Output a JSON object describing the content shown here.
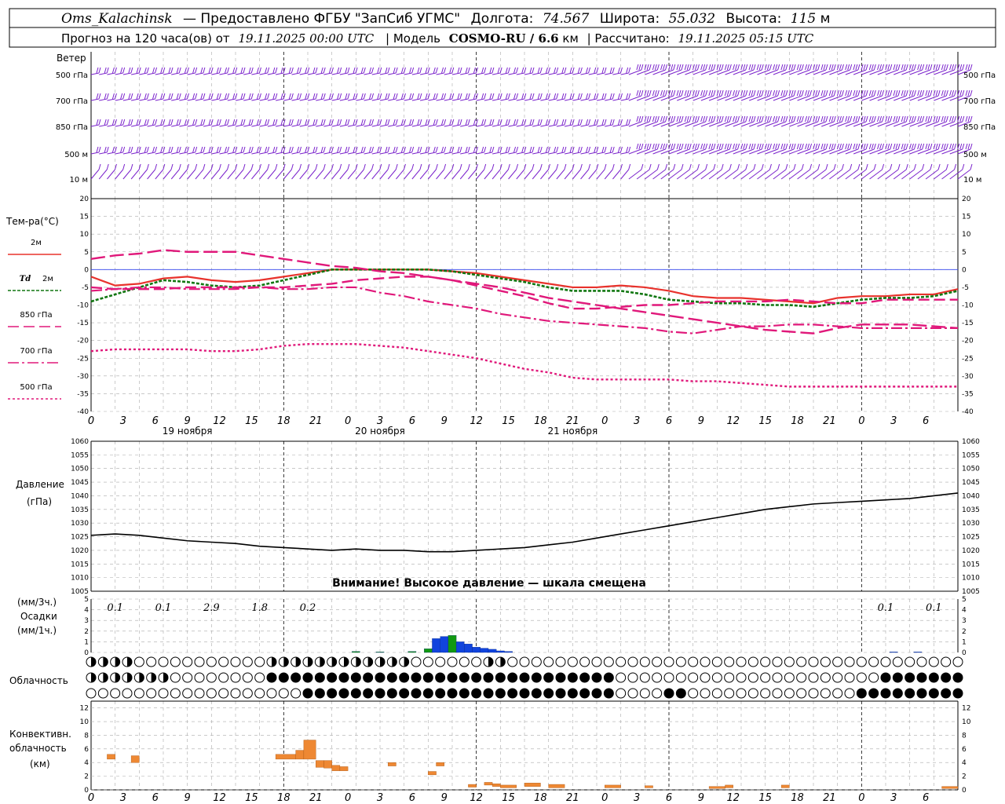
{
  "header": {
    "station": "Oms_Kalachinsk",
    "provided": "— Предоставлено ФГБУ \"ЗапСиб УГМС\"",
    "lon_label": "Долгота:",
    "lon": "74.567",
    "lat_label": "Широта:",
    "lat": "55.032",
    "alt_label": "Высота:",
    "alt": "115",
    "alt_unit": "м",
    "forecast_label": "Прогноз на 120 часа(ов) от",
    "forecast_time": "19.11.2025 00:00 UTC",
    "model_label": "| Модель",
    "model": "COSMO-RU / 6.6",
    "model_unit": "км",
    "calc_label": "| Рассчитано:",
    "calc_time": "19.11.2025 05:15 UTC"
  },
  "wind_panel": {
    "title": "Ветер",
    "levels": [
      "500 гПа",
      "700 гПа",
      "850 гПа",
      "500 м",
      "10 м"
    ]
  },
  "temp_panel": {
    "title": "Тем-ра(°C)",
    "legend": [
      {
        "label": "2м",
        "color": "#e8322c"
      },
      {
        "label": "Td",
        "label2": "2м",
        "color": "#117711"
      },
      {
        "label": "850 гПа",
        "color": "#e0187a"
      },
      {
        "label": "700 гПа",
        "color": "#e0187a"
      },
      {
        "label": "500 гПа",
        "color": "#e0187a"
      }
    ],
    "yticks": [
      "20",
      "15",
      "10",
      "5",
      "0",
      "-5",
      "-10",
      "-15",
      "-20",
      "-25",
      "-30",
      "-35",
      "-40"
    ]
  },
  "xaxis": {
    "hours": [
      "0",
      "3",
      "6",
      "9",
      "12",
      "15",
      "18",
      "21",
      "0",
      "3",
      "6",
      "9",
      "12",
      "15",
      "18",
      "21",
      "0",
      "3",
      "6",
      "9",
      "12",
      "15",
      "18",
      "21",
      "0",
      "3",
      "6"
    ],
    "days": [
      "19 ноября",
      "20 ноября",
      "21 ноября"
    ]
  },
  "pressure_panel": {
    "title": "Давление",
    "unit": "(гПа)",
    "warning": "Внимание! Высокое давление — шкала смещена",
    "yticks": [
      "1060",
      "1055",
      "1050",
      "1045",
      "1040",
      "1035",
      "1030",
      "1025",
      "1020",
      "1015",
      "1010",
      "1005"
    ]
  },
  "precip_panel": {
    "unit3": "(мм/3ч.)",
    "title": "Осадки",
    "unit1": "(мм/1ч.)",
    "yticks": [
      "5",
      "4",
      "3",
      "2",
      "1",
      "0"
    ],
    "totals": [
      {
        "h": 3,
        "v": "0.1"
      },
      {
        "h": 9,
        "v": "0.1"
      },
      {
        "h": 15,
        "v": "2.9"
      },
      {
        "h": 21,
        "v": "1.8"
      },
      {
        "h": 27,
        "v": "0.2"
      },
      {
        "h": 99,
        "v": "0.1"
      },
      {
        "h": 105,
        "v": "0.1"
      }
    ]
  },
  "cloud_panel": {
    "title": "Облачность"
  },
  "conv_panel": {
    "title1": "Конвективн.",
    "title2": "облачность",
    "unit": "(км)",
    "yticks": [
      "12",
      "10",
      "8",
      "6",
      "4",
      "2",
      "0"
    ]
  },
  "chart_data": [
    {
      "type": "line",
      "title": "Тем-ра(°C)",
      "x_hours": [
        0,
        3,
        6,
        9,
        12,
        15,
        18,
        21,
        24,
        27,
        30,
        33,
        36,
        39,
        42,
        45,
        48,
        51,
        54,
        57,
        60,
        63,
        66,
        69,
        72,
        75,
        78,
        81,
        84,
        87,
        90,
        93,
        96,
        99,
        102,
        105,
        108
      ],
      "ylim": [
        -40,
        20
      ],
      "series": [
        {
          "name": "2м",
          "color": "#e8322c",
          "values": [
            -2,
            -4.5,
            -4,
            -2.5,
            -2,
            -3,
            -3.5,
            -3,
            -2,
            -1,
            0,
            0,
            0,
            0,
            0,
            -0.5,
            -1,
            -2,
            -3,
            -4,
            -5,
            -5,
            -4.5,
            -5,
            -6,
            -7.5,
            -8,
            -8,
            -8.5,
            -9,
            -9.5,
            -8,
            -7.5,
            -7.5,
            -7,
            -7,
            -5.5
          ]
        },
        {
          "name": "Td 2м",
          "color": "#117711",
          "values": [
            -9,
            -7,
            -5,
            -3,
            -3.5,
            -4.5,
            -5,
            -4.5,
            -3,
            -1.5,
            0,
            0,
            0,
            0,
            0,
            -0.5,
            -1.5,
            -2.5,
            -3.5,
            -5,
            -6,
            -6,
            -6,
            -7,
            -8.5,
            -9,
            -9.5,
            -9.5,
            -10,
            -10,
            -10.5,
            -9.5,
            -8.5,
            -8,
            -8,
            -7.5,
            -6
          ]
        },
        {
          "name": "850 гПа",
          "color": "#e0187a",
          "values": [
            -5,
            -5.5,
            -5.5,
            -5.5,
            -5,
            -5,
            -5,
            -5,
            -5,
            -4.5,
            -4,
            -3,
            -2.5,
            -2,
            -2,
            -3,
            -4.5,
            -6,
            -7.5,
            -9.5,
            -11,
            -11,
            -10.5,
            -10,
            -10,
            -9.5,
            -9,
            -9,
            -9,
            -8.5,
            -9,
            -9.5,
            -9.5,
            -8.5,
            -8.5,
            -8.5,
            -8.5
          ]
        },
        {
          "name": "700 гПа",
          "color": "#e0187a",
          "values": [
            -6,
            -5.5,
            -5,
            -5,
            -5.5,
            -5.5,
            -5.5,
            -5,
            -5.5,
            -5.5,
            -5,
            -5,
            -6.5,
            -7.5,
            -9,
            -10,
            -11,
            -12.5,
            -13.5,
            -14.5,
            -15,
            -15.5,
            -16,
            -16.5,
            -17.5,
            -18,
            -17,
            -16,
            -16,
            -15.5,
            -15.5,
            -16,
            -16.5,
            -16.5,
            -16.5,
            -16.5,
            -16.5
          ]
        },
        {
          "name": "500 гПа",
          "color": "#e0187a",
          "values": [
            3,
            4,
            4.5,
            5.5,
            5,
            5,
            5,
            4,
            3,
            2,
            1,
            0.5,
            -0.5,
            -1,
            -2,
            -3,
            -4,
            -5,
            -6.5,
            -8,
            -9,
            -10,
            -11,
            -12,
            -13,
            -14,
            -15,
            -16,
            -17,
            -17.5,
            -18,
            -16.5,
            -15.5,
            -15.5,
            -15.5,
            -16,
            -16.5
          ]
        },
        {
          "name": "500 гПа (нижняя)",
          "color": "#e0187a",
          "values": [
            -23,
            -22.5,
            -22.5,
            -22.5,
            -22.5,
            -23,
            -23,
            -22.5,
            -21.5,
            -21,
            -21,
            -21,
            -21.5,
            -22,
            -23,
            -24,
            -25,
            -26.5,
            -28,
            -29,
            -30.5,
            -31,
            -31,
            -31,
            -31,
            -31.5,
            -31.5,
            -32,
            -32.5,
            -33,
            -33,
            -33,
            -33,
            -33,
            -33,
            -33,
            -33
          ]
        }
      ]
    },
    {
      "type": "line",
      "title": "Давление",
      "x_hours": [
        0,
        3,
        6,
        9,
        12,
        15,
        18,
        21,
        24,
        27,
        30,
        33,
        36,
        39,
        42,
        45,
        48,
        51,
        54,
        57,
        60,
        63,
        66,
        69,
        72,
        75,
        78,
        81,
        84,
        87,
        90,
        93,
        96,
        99,
        102,
        105,
        108
      ],
      "ylim": [
        1005,
        1060
      ],
      "values": [
        1025.5,
        1026,
        1025.5,
        1024.5,
        1023.5,
        1023,
        1022.5,
        1021.5,
        1021,
        1020.5,
        1020,
        1020.5,
        1020,
        1020,
        1019.5,
        1019.5,
        1020,
        1020.5,
        1021,
        1022,
        1023,
        1024.5,
        1026,
        1027.5,
        1029,
        1030.5,
        1032,
        1033.5,
        1035,
        1036,
        1037,
        1037.5,
        1038,
        1038.5,
        1039,
        1040,
        1041
      ]
    },
    {
      "type": "bar",
      "title": "Осадки",
      "ylim": [
        0,
        5
      ],
      "bars": [
        {
          "h": 33,
          "v": 0.1,
          "c": "#119911"
        },
        {
          "h": 36,
          "v": 0.05,
          "c": "#119911"
        },
        {
          "h": 40,
          "v": 0.1,
          "c": "#119911"
        },
        {
          "h": 42,
          "v": 0.35,
          "c": "#119911"
        },
        {
          "h": 43,
          "v": 1.3,
          "c": "#1144dd"
        },
        {
          "h": 44,
          "v": 1.5,
          "c": "#1144dd"
        },
        {
          "h": 45,
          "v": 1.6,
          "c": "#119911"
        },
        {
          "h": 46,
          "v": 1.0,
          "c": "#1144dd"
        },
        {
          "h": 47,
          "v": 0.8,
          "c": "#1144dd"
        },
        {
          "h": 48,
          "v": 0.5,
          "c": "#1144dd"
        },
        {
          "h": 49,
          "v": 0.4,
          "c": "#1144dd"
        },
        {
          "h": 50,
          "v": 0.3,
          "c": "#1144dd"
        },
        {
          "h": 51,
          "v": 0.15,
          "c": "#1144dd"
        },
        {
          "h": 52,
          "v": 0.1,
          "c": "#1144dd"
        },
        {
          "h": 100,
          "v": 0.05,
          "c": "#1144dd"
        },
        {
          "h": 103,
          "v": 0.05,
          "c": "#1144dd"
        }
      ]
    },
    {
      "type": "bar",
      "title": "Конвективн. облачность",
      "ylim": [
        0,
        13
      ],
      "segments": [
        {
          "h0": 2,
          "h1": 3,
          "lo": 4.5,
          "hi": 5.2
        },
        {
          "h0": 5,
          "h1": 6,
          "lo": 4,
          "hi": 5
        },
        {
          "h0": 23,
          "h1": 25.5,
          "lo": 4.5,
          "hi": 5.2
        },
        {
          "h0": 25.5,
          "h1": 26.5,
          "lo": 4.5,
          "hi": 5.8
        },
        {
          "h0": 26.5,
          "h1": 28,
          "lo": 4.5,
          "hi": 7.3
        },
        {
          "h0": 28,
          "h1": 29,
          "lo": 3.3,
          "hi": 4.3
        },
        {
          "h0": 29,
          "h1": 30,
          "lo": 3.2,
          "hi": 4.3
        },
        {
          "h0": 30,
          "h1": 31,
          "lo": 2.8,
          "hi": 3.6
        },
        {
          "h0": 31,
          "h1": 32,
          "lo": 2.8,
          "hi": 3.4
        },
        {
          "h0": 37,
          "h1": 38,
          "lo": 3.5,
          "hi": 4
        },
        {
          "h0": 42,
          "h1": 43,
          "lo": 2.2,
          "hi": 2.7
        },
        {
          "h0": 43,
          "h1": 44,
          "lo": 3.5,
          "hi": 4
        },
        {
          "h0": 47,
          "h1": 48,
          "lo": 0.4,
          "hi": 0.8
        },
        {
          "h0": 49,
          "h1": 50,
          "lo": 0.7,
          "hi": 1.1
        },
        {
          "h0": 50,
          "h1": 51,
          "lo": 0.5,
          "hi": 0.9
        },
        {
          "h0": 51,
          "h1": 53,
          "lo": 0.3,
          "hi": 0.7
        },
        {
          "h0": 54,
          "h1": 56,
          "lo": 0.5,
          "hi": 1
        },
        {
          "h0": 57,
          "h1": 59,
          "lo": 0.3,
          "hi": 0.8
        },
        {
          "h0": 64,
          "h1": 66,
          "lo": 0.3,
          "hi": 0.7
        },
        {
          "h0": 69,
          "h1": 70,
          "lo": 0.3,
          "hi": 0.6
        },
        {
          "h0": 77,
          "h1": 79,
          "lo": 0.2,
          "hi": 0.5
        },
        {
          "h0": 79,
          "h1": 80,
          "lo": 0.3,
          "hi": 0.7
        },
        {
          "h0": 86,
          "h1": 87,
          "lo": 0.3,
          "hi": 0.7
        },
        {
          "h0": 106,
          "h1": 108,
          "lo": 0.2,
          "hi": 0.5
        }
      ]
    }
  ]
}
